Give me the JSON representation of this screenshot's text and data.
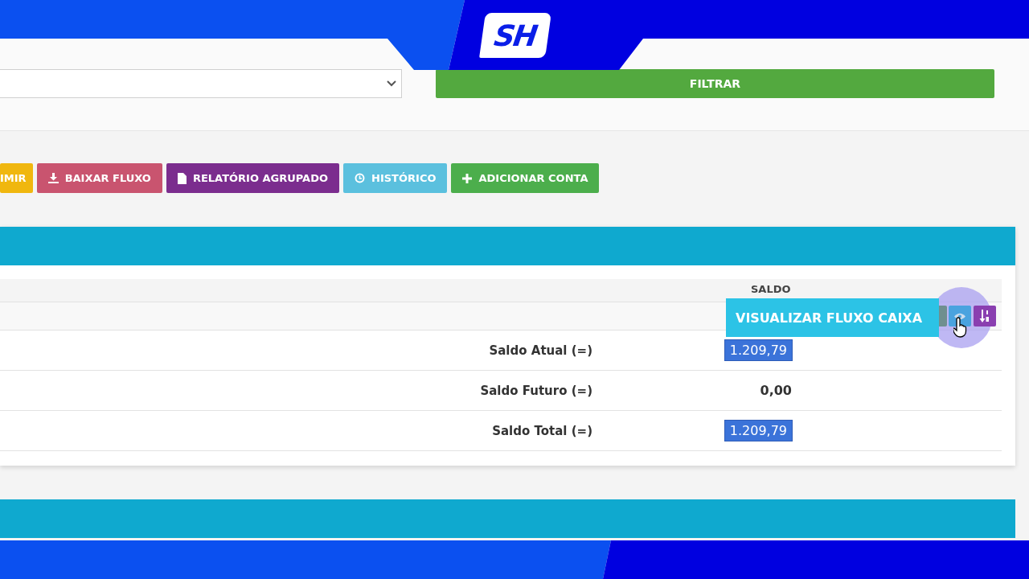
{
  "logo": {
    "text": "SH"
  },
  "filter": {
    "button": "FILTRAR"
  },
  "actions": [
    {
      "label": "IMIR",
      "kind": "plain",
      "color": "#f0b70f"
    },
    {
      "label": "BAIXAR FLUXO",
      "kind": "download",
      "color": "#c9546f"
    },
    {
      "label": "RELATÓRIO AGRUPADO",
      "kind": "report",
      "color": "#7b2d8e"
    },
    {
      "label": "HISTÓRICO",
      "kind": "history",
      "color": "#5bc0de"
    },
    {
      "label": "ADICIONAR CONTA",
      "kind": "add",
      "color": "#4cae4c"
    }
  ],
  "table": {
    "columns": [
      "SALDO"
    ],
    "tooltip": "VISUALIZAR FLUXO CAIXA",
    "rows": [
      {
        "label": "Saldo Atual (=)",
        "value": "1.209,79",
        "highlighted": true
      },
      {
        "label": "Saldo Futuro (=)",
        "value": "0,00",
        "highlighted": false
      },
      {
        "label": "Saldo Total (=)",
        "value": "1.209,79",
        "highlighted": true
      }
    ]
  }
}
